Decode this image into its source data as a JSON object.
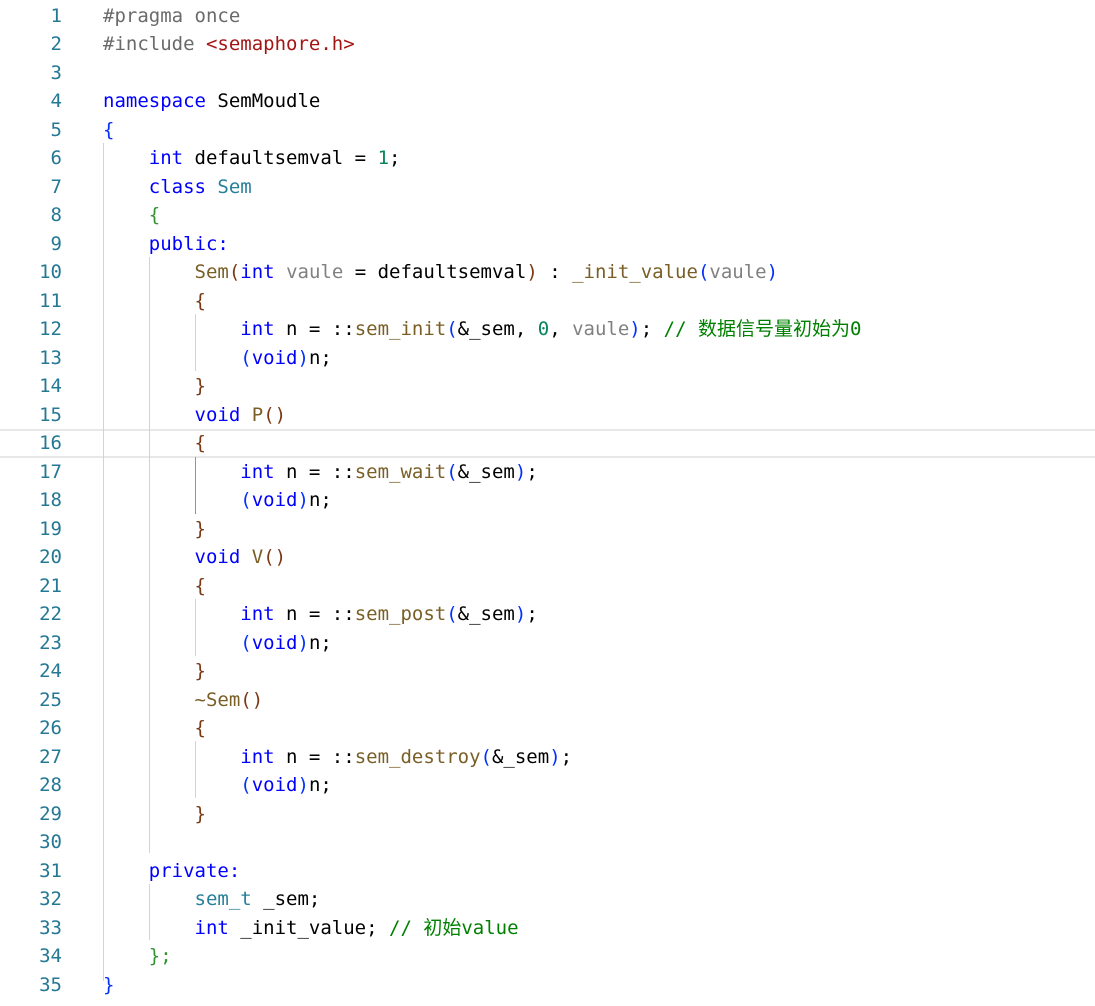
{
  "editor": {
    "language": "cpp",
    "current_line": 16,
    "lines": [
      {
        "n": "1",
        "tokens": [
          [
            "pp",
            "#pragma once"
          ]
        ]
      },
      {
        "n": "2",
        "tokens": [
          [
            "pp",
            "#include "
          ],
          [
            "str",
            "<semaphore.h>"
          ]
        ]
      },
      {
        "n": "3",
        "tokens": []
      },
      {
        "n": "4",
        "tokens": [
          [
            "kw",
            "namespace"
          ],
          [
            "plain",
            " SemMoudle"
          ]
        ]
      },
      {
        "n": "5",
        "tokens": [
          [
            "br1",
            "{"
          ]
        ]
      },
      {
        "n": "6",
        "tokens": [
          [
            "plain",
            "    "
          ],
          [
            "kw",
            "int"
          ],
          [
            "plain",
            " defaultsemval = "
          ],
          [
            "num",
            "1"
          ],
          [
            "plain",
            ";"
          ]
        ]
      },
      {
        "n": "7",
        "tokens": [
          [
            "plain",
            "    "
          ],
          [
            "kw",
            "class"
          ],
          [
            "plain",
            " "
          ],
          [
            "type",
            "Sem"
          ]
        ]
      },
      {
        "n": "8",
        "tokens": [
          [
            "plain",
            "    "
          ],
          [
            "br2",
            "{"
          ]
        ]
      },
      {
        "n": "9",
        "tokens": [
          [
            "plain",
            "    "
          ],
          [
            "kw",
            "public:"
          ]
        ]
      },
      {
        "n": "10",
        "tokens": [
          [
            "plain",
            "        "
          ],
          [
            "fn",
            "Sem"
          ],
          [
            "br3",
            "("
          ],
          [
            "kw",
            "int"
          ],
          [
            "plain",
            " "
          ],
          [
            "param",
            "vaule"
          ],
          [
            "plain",
            " = defaultsemval"
          ],
          [
            "br3",
            ")"
          ],
          [
            "plain",
            " : "
          ],
          [
            "fn",
            "_init_value"
          ],
          [
            "br1",
            "("
          ],
          [
            "param",
            "vaule"
          ],
          [
            "br1",
            ")"
          ]
        ]
      },
      {
        "n": "11",
        "tokens": [
          [
            "plain",
            "        "
          ],
          [
            "br3",
            "{"
          ]
        ]
      },
      {
        "n": "12",
        "tokens": [
          [
            "plain",
            "            "
          ],
          [
            "kw",
            "int"
          ],
          [
            "plain",
            " n = ::"
          ],
          [
            "fn",
            "sem_init"
          ],
          [
            "br1",
            "("
          ],
          [
            "plain",
            "&_sem, "
          ],
          [
            "num",
            "0"
          ],
          [
            "plain",
            ", "
          ],
          [
            "param",
            "vaule"
          ],
          [
            "br1",
            ")"
          ],
          [
            "plain",
            "; "
          ],
          [
            "cmt",
            "// 数据信号量初始为0"
          ]
        ]
      },
      {
        "n": "13",
        "tokens": [
          [
            "plain",
            "            "
          ],
          [
            "br1",
            "("
          ],
          [
            "kw",
            "void"
          ],
          [
            "br1",
            ")"
          ],
          [
            "plain",
            "n;"
          ]
        ]
      },
      {
        "n": "14",
        "tokens": [
          [
            "plain",
            "        "
          ],
          [
            "br3",
            "}"
          ]
        ]
      },
      {
        "n": "15",
        "tokens": [
          [
            "plain",
            "        "
          ],
          [
            "kw",
            "void"
          ],
          [
            "plain",
            " "
          ],
          [
            "fn",
            "P"
          ],
          [
            "br3",
            "()"
          ]
        ]
      },
      {
        "n": "16",
        "tokens": [
          [
            "plain",
            "        "
          ],
          [
            "br3",
            "{"
          ]
        ]
      },
      {
        "n": "17",
        "tokens": [
          [
            "plain",
            "            "
          ],
          [
            "kw",
            "int"
          ],
          [
            "plain",
            " n = ::"
          ],
          [
            "fn",
            "sem_wait"
          ],
          [
            "br1",
            "("
          ],
          [
            "plain",
            "&_sem"
          ],
          [
            "br1",
            ")"
          ],
          [
            "plain",
            ";"
          ]
        ]
      },
      {
        "n": "18",
        "tokens": [
          [
            "plain",
            "            "
          ],
          [
            "br1",
            "("
          ],
          [
            "kw",
            "void"
          ],
          [
            "br1",
            ")"
          ],
          [
            "plain",
            "n;"
          ]
        ]
      },
      {
        "n": "19",
        "tokens": [
          [
            "plain",
            "        "
          ],
          [
            "br3",
            "}"
          ]
        ]
      },
      {
        "n": "20",
        "tokens": [
          [
            "plain",
            "        "
          ],
          [
            "kw",
            "void"
          ],
          [
            "plain",
            " "
          ],
          [
            "fn",
            "V"
          ],
          [
            "br3",
            "()"
          ]
        ]
      },
      {
        "n": "21",
        "tokens": [
          [
            "plain",
            "        "
          ],
          [
            "br3",
            "{"
          ]
        ]
      },
      {
        "n": "22",
        "tokens": [
          [
            "plain",
            "            "
          ],
          [
            "kw",
            "int"
          ],
          [
            "plain",
            " n = ::"
          ],
          [
            "fn",
            "sem_post"
          ],
          [
            "br1",
            "("
          ],
          [
            "plain",
            "&_sem"
          ],
          [
            "br1",
            ")"
          ],
          [
            "plain",
            ";"
          ]
        ]
      },
      {
        "n": "23",
        "tokens": [
          [
            "plain",
            "            "
          ],
          [
            "br1",
            "("
          ],
          [
            "kw",
            "void"
          ],
          [
            "br1",
            ")"
          ],
          [
            "plain",
            "n;"
          ]
        ]
      },
      {
        "n": "24",
        "tokens": [
          [
            "plain",
            "        "
          ],
          [
            "br3",
            "}"
          ]
        ]
      },
      {
        "n": "25",
        "tokens": [
          [
            "plain",
            "        "
          ],
          [
            "fn",
            "~Sem"
          ],
          [
            "br3",
            "()"
          ]
        ]
      },
      {
        "n": "26",
        "tokens": [
          [
            "plain",
            "        "
          ],
          [
            "br3",
            "{"
          ]
        ]
      },
      {
        "n": "27",
        "tokens": [
          [
            "plain",
            "            "
          ],
          [
            "kw",
            "int"
          ],
          [
            "plain",
            " n = ::"
          ],
          [
            "fn",
            "sem_destroy"
          ],
          [
            "br1",
            "("
          ],
          [
            "plain",
            "&_sem"
          ],
          [
            "br1",
            ")"
          ],
          [
            "plain",
            ";"
          ]
        ]
      },
      {
        "n": "28",
        "tokens": [
          [
            "plain",
            "            "
          ],
          [
            "br1",
            "("
          ],
          [
            "kw",
            "void"
          ],
          [
            "br1",
            ")"
          ],
          [
            "plain",
            "n;"
          ]
        ]
      },
      {
        "n": "29",
        "tokens": [
          [
            "plain",
            "        "
          ],
          [
            "br3",
            "}"
          ]
        ]
      },
      {
        "n": "30",
        "tokens": []
      },
      {
        "n": "31",
        "tokens": [
          [
            "plain",
            "    "
          ],
          [
            "kw",
            "private:"
          ]
        ]
      },
      {
        "n": "32",
        "tokens": [
          [
            "plain",
            "        "
          ],
          [
            "type",
            "sem_t"
          ],
          [
            "plain",
            " _sem;"
          ]
        ]
      },
      {
        "n": "33",
        "tokens": [
          [
            "plain",
            "        "
          ],
          [
            "kw",
            "int"
          ],
          [
            "plain",
            " _init_value; "
          ],
          [
            "cmt",
            "// 初始value"
          ]
        ]
      },
      {
        "n": "34",
        "tokens": [
          [
            "plain",
            "    "
          ],
          [
            "br2",
            "};"
          ]
        ]
      },
      {
        "n": "35",
        "tokens": [
          [
            "br1",
            "}"
          ]
        ]
      }
    ]
  },
  "colors": {
    "line_number": "#237893",
    "preprocessor": "#6a6a6a",
    "string": "#a31515",
    "keyword": "#0000ff",
    "type": "#267f99",
    "function": "#795e26",
    "number": "#098658",
    "parameter": "#808080",
    "comment": "#008000"
  }
}
